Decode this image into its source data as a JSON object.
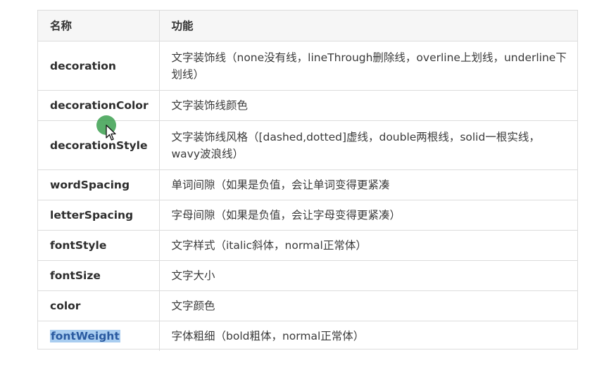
{
  "header": {
    "name": "名称",
    "function": "功能"
  },
  "rows": [
    {
      "name": "decoration",
      "desc": "文字装饰线（none没有线，lineThrough删除线，overline上划线，underline下划线）"
    },
    {
      "name": "decorationColor",
      "desc": "文字装饰线颜色"
    },
    {
      "name": "decorationStyle",
      "desc": "文字装饰线风格（[dashed,dotted]虚线，double两根线，solid一根实线，wavy波浪线）"
    },
    {
      "name": "wordSpacing",
      "desc": "单词间隙（如果是负值，会让单词变得更紧凑"
    },
    {
      "name": "letterSpacing",
      "desc": "字母间隙（如果是负值，会让字母变得更紧凑）"
    },
    {
      "name": "fontStyle",
      "desc": "文字样式（italic斜体，normal正常体）"
    },
    {
      "name": "fontSize",
      "desc": "文字大小"
    },
    {
      "name": "color",
      "desc": "文字颜色"
    },
    {
      "name": "fontWeight",
      "desc": "字体粗细（bold粗体，normal正常体）"
    }
  ],
  "colors": {
    "highlight": "#a9cdf0",
    "cursor": "#3ca050"
  }
}
